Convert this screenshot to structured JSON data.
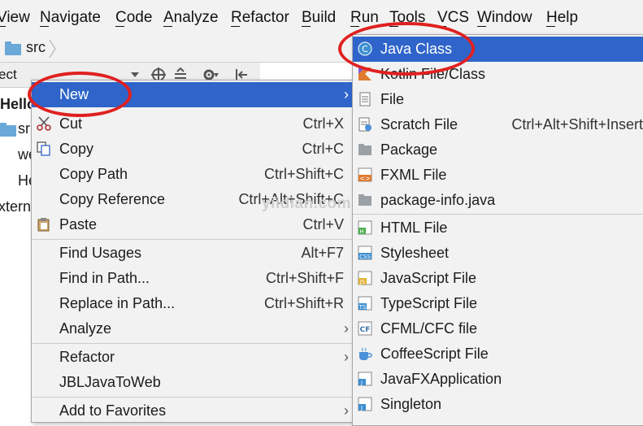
{
  "menubar": {
    "items": [
      "View",
      "Navigate",
      "Code",
      "Analyze",
      "Refactor",
      "Build",
      "Run",
      "Tools",
      "VCS",
      "Window",
      "Help"
    ]
  },
  "navbar": {
    "crumb": "src"
  },
  "project_panel": {
    "title": "ect",
    "tree": [
      "Hello",
      "sr",
      "we",
      "He",
      "xtern"
    ]
  },
  "context_menu": {
    "new": "New",
    "cut": "Cut",
    "cut_sc": "Ctrl+X",
    "copy": "Copy",
    "copy_sc": "Ctrl+C",
    "copy_path": "Copy Path",
    "copy_path_sc": "Ctrl+Shift+C",
    "copy_ref": "Copy Reference",
    "copy_ref_sc": "Ctrl+Alt+Shift+C",
    "paste": "Paste",
    "paste_sc": "Ctrl+V",
    "find_usages": "Find Usages",
    "find_usages_sc": "Alt+F7",
    "find_in_path": "Find in Path...",
    "find_in_path_sc": "Ctrl+Shift+F",
    "replace_in_path": "Replace in Path...",
    "replace_in_path_sc": "Ctrl+Shift+R",
    "analyze": "Analyze",
    "refactor": "Refactor",
    "jbl": "JBLJavaToWeb",
    "add_fav": "Add to Favorites"
  },
  "new_submenu": {
    "java_class": "Java Class",
    "kotlin": "Kotlin File/Class",
    "file": "File",
    "scratch": "Scratch File",
    "scratch_sc": "Ctrl+Alt+Shift+Insert",
    "package": "Package",
    "fxml": "FXML File",
    "pkg_info": "package-info.java",
    "html": "HTML File",
    "stylesheet": "Stylesheet",
    "js": "JavaScript File",
    "ts": "TypeScript File",
    "cfml": "CFML/CFC file",
    "coffee": "CoffeeScript File",
    "javafx": "JavaFXApplication",
    "singleton": "Singleton"
  },
  "watermark": "yiidian.com",
  "colors": {
    "selection": "#2f65ca",
    "highlight_ring": "#e02020"
  }
}
